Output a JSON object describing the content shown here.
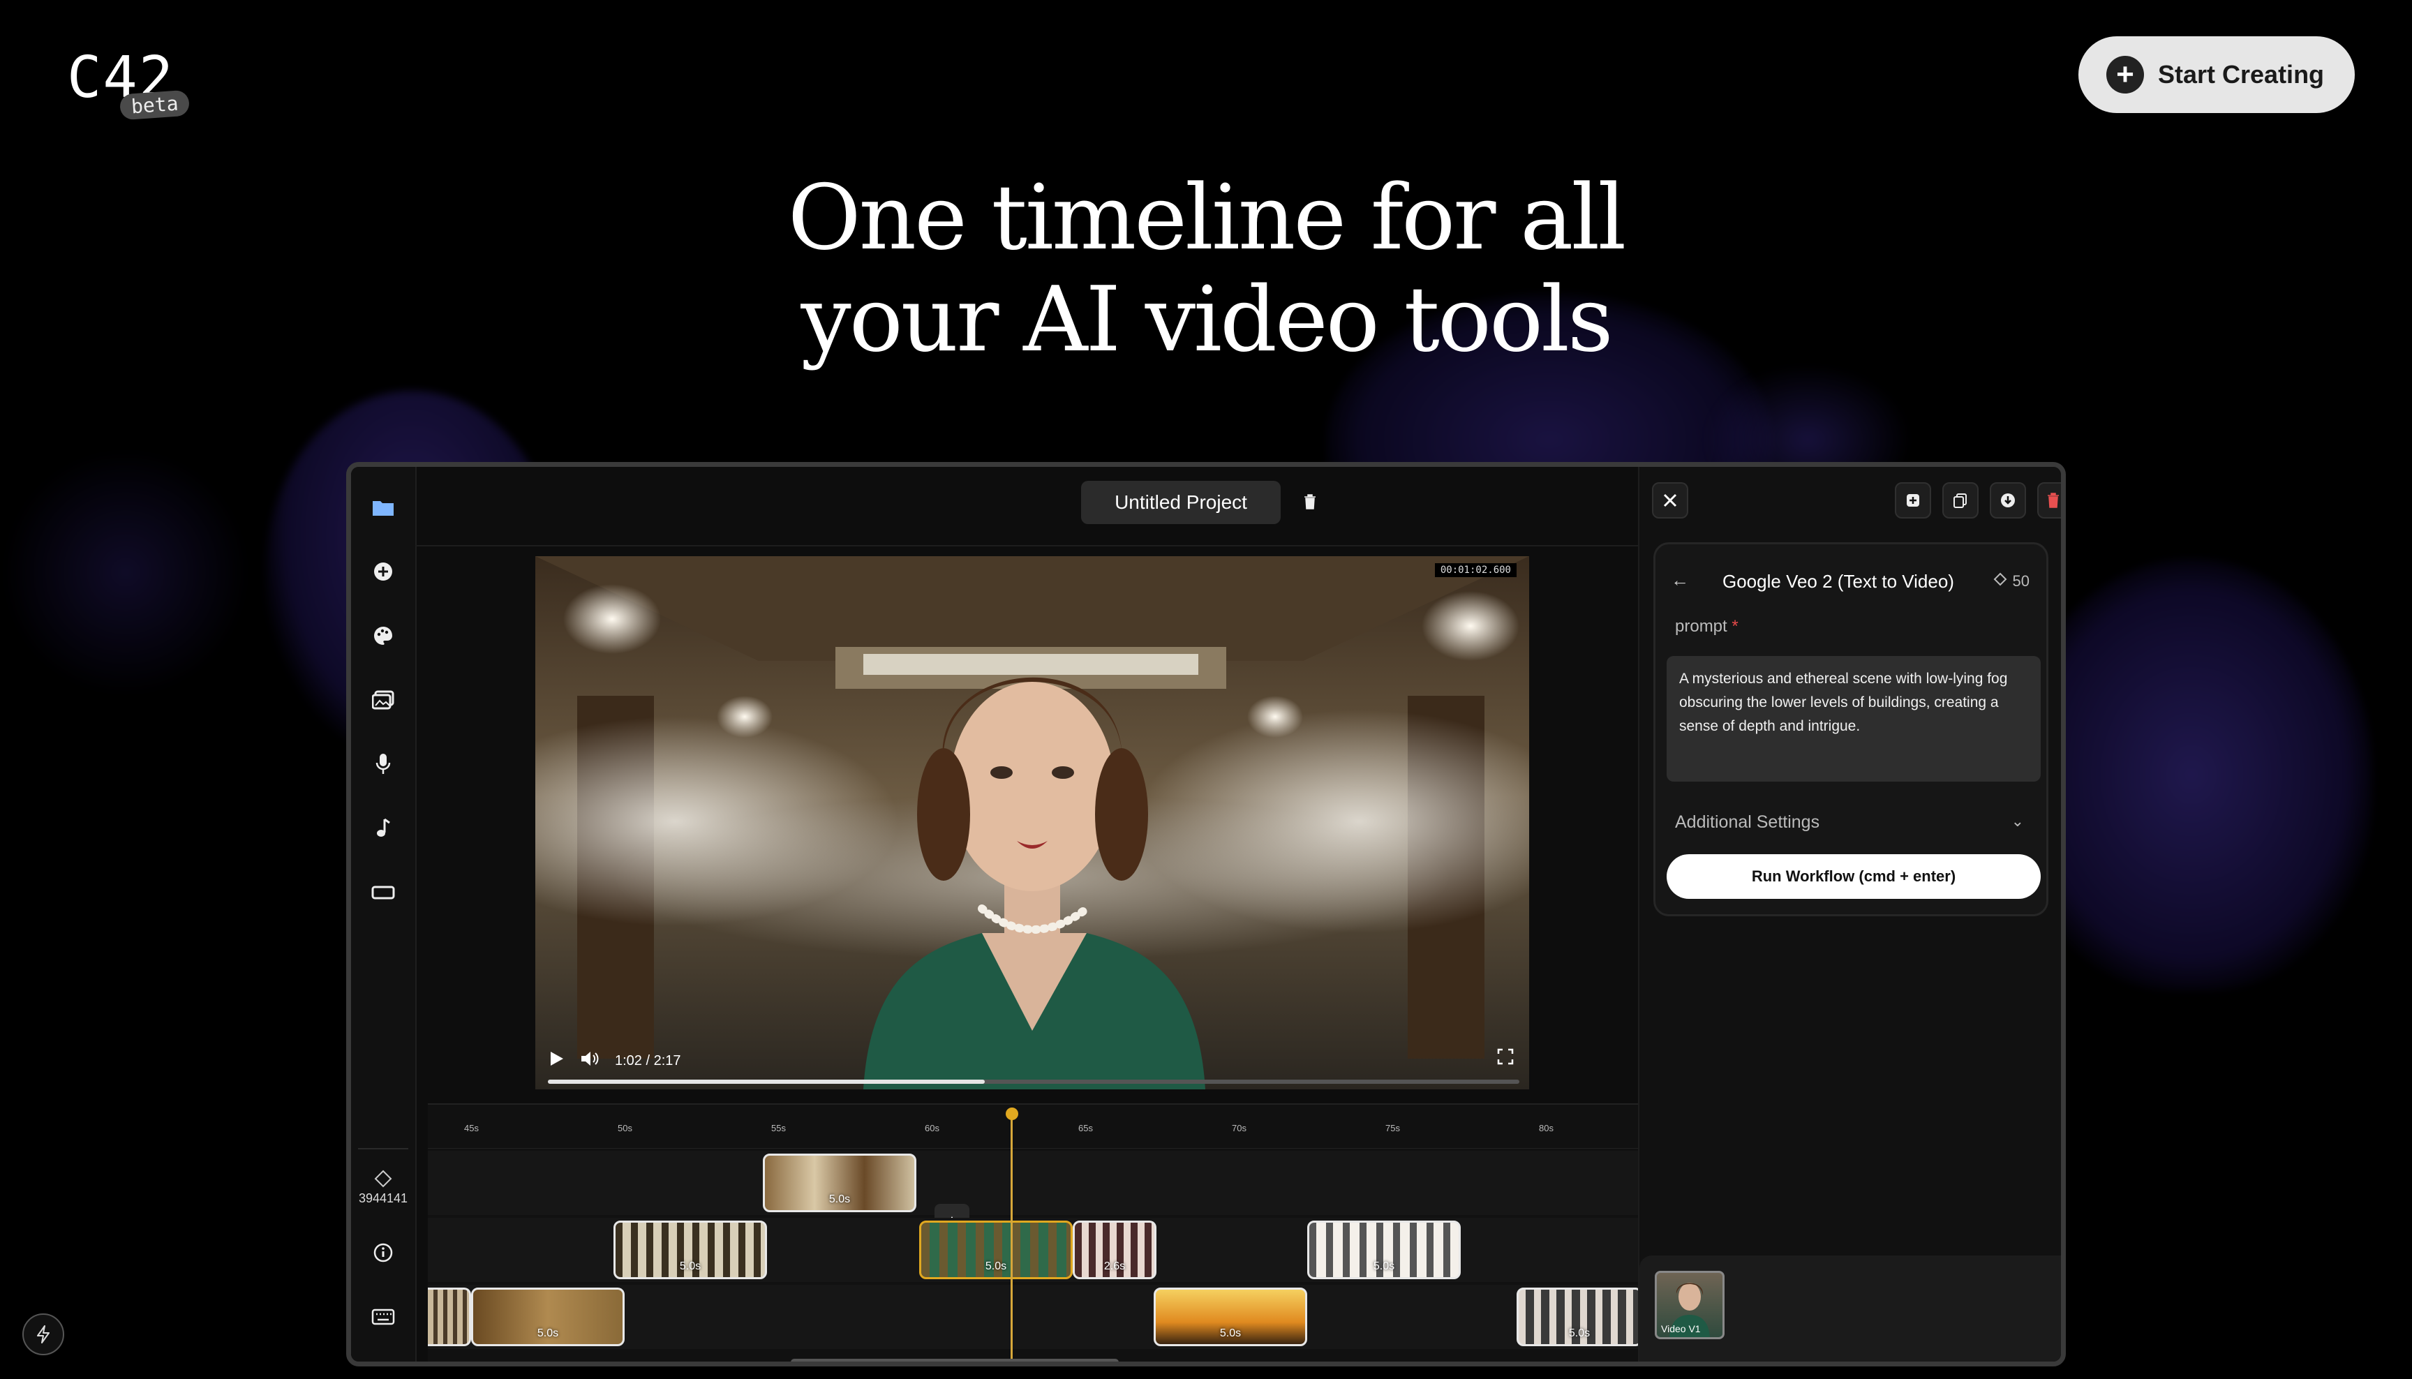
{
  "brand": {
    "logo": "C42",
    "badge": "beta"
  },
  "header": {
    "cta_label": "Start Creating"
  },
  "hero": {
    "line1": "One timeline for all",
    "line2": "your AI video tools"
  },
  "editor": {
    "project_title": "Untitled Project",
    "credits": "3944141",
    "player": {
      "timecode": "00:01:02.600",
      "time": "1:02 / 2:17",
      "progress": 0.45
    },
    "timeline": {
      "ticks": [
        "45s",
        "50s",
        "55s",
        "60s",
        "65s",
        "70s",
        "75s",
        "80s"
      ],
      "tracks": [
        {
          "clips": [
            {
              "label": "5.0s"
            }
          ]
        },
        {
          "clips": [
            {
              "label": "5.0s"
            },
            {
              "label": "5.0s"
            },
            {
              "label": "2.6s"
            },
            {
              "label": "5.0s"
            }
          ]
        },
        {
          "clips": [
            {
              "label": ""
            },
            {
              "label": "5.0s"
            },
            {
              "label": "5.0s"
            },
            {
              "label": "5.0s"
            }
          ]
        }
      ]
    },
    "panel": {
      "model_title": "Google Veo 2 (Text to Video)",
      "cost": "50",
      "prompt_label": "prompt",
      "prompt_required": "*",
      "prompt_text": "A mysterious and ethereal scene with low-lying fog obscuring the lower levels of buildings, creating a sense of depth and intrigue.",
      "additional_settings": "Additional Settings",
      "run_button": "Run Workflow (cmd + enter)",
      "thumbnail_label": "Video V1"
    }
  },
  "colors": {
    "accent": "#e0a820",
    "background": "#000000",
    "button": "#e6e6e6"
  }
}
